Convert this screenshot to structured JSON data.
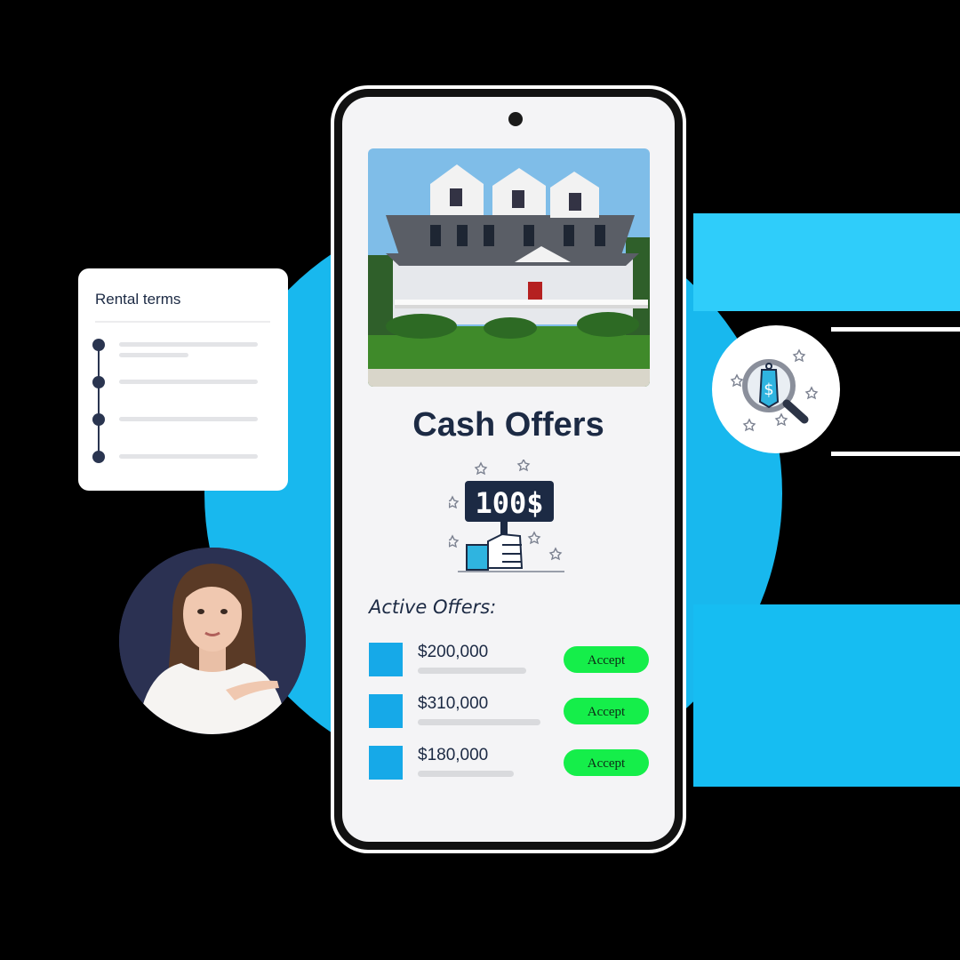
{
  "screen": {
    "title": "Cash Offers",
    "sign_text": "100$",
    "active_offers_label": "Active Offers:",
    "offers": [
      {
        "amount": "$200,000",
        "button": "Accept"
      },
      {
        "amount": "$310,000",
        "button": "Accept"
      },
      {
        "amount": "$180,000",
        "button": "Accept"
      }
    ]
  },
  "rental_card": {
    "title": "Rental terms"
  },
  "badge": {
    "tag_symbol": "$"
  },
  "colors": {
    "accent_blue": "#16a9e8",
    "accept_green": "#15ee4a",
    "navy_text": "#1c2a44"
  }
}
